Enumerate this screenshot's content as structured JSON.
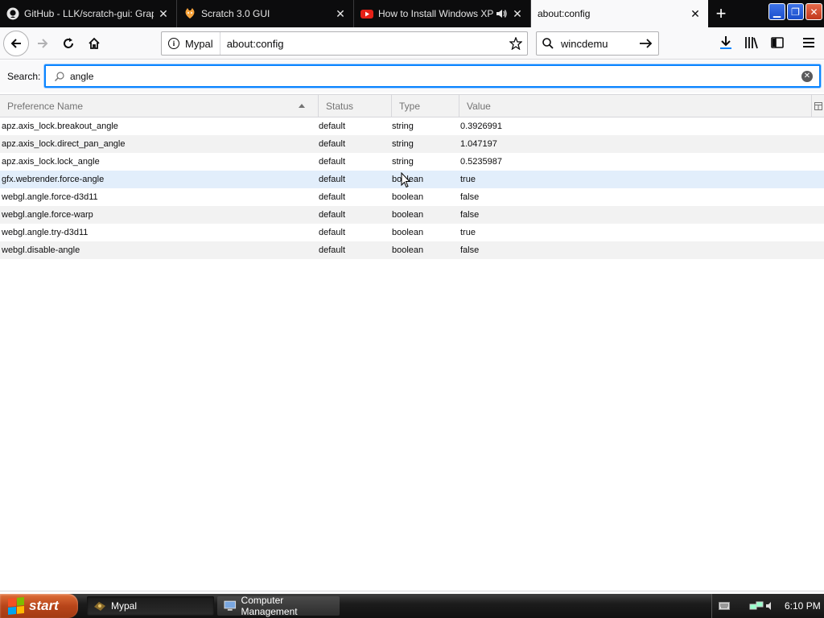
{
  "tabs": [
    {
      "title": "GitHub - LLK/scratch-gui: Graphical",
      "icon": "github-icon",
      "active": false
    },
    {
      "title": "Scratch 3.0 GUI",
      "icon": "scratch-cat-icon",
      "active": false
    },
    {
      "title": "How to Install Windows XP KVM",
      "icon": "youtube-icon",
      "active": false,
      "audio": true
    },
    {
      "title": "about:config",
      "icon": "",
      "active": true
    }
  ],
  "toolbar": {
    "identity_label": "Mypal",
    "url": "about:config",
    "search_value": "wincdemu"
  },
  "config": {
    "search_label": "Search:",
    "search_value": "angle",
    "columns": {
      "name": "Preference Name",
      "status": "Status",
      "type": "Type",
      "value": "Value"
    },
    "rows": [
      {
        "name": "apz.axis_lock.breakout_angle",
        "status": "default",
        "type": "string",
        "value": "0.3926991"
      },
      {
        "name": "apz.axis_lock.direct_pan_angle",
        "status": "default",
        "type": "string",
        "value": "1.047197"
      },
      {
        "name": "apz.axis_lock.lock_angle",
        "status": "default",
        "type": "string",
        "value": "0.5235987"
      },
      {
        "name": "gfx.webrender.force-angle",
        "status": "default",
        "type": "boolean",
        "value": "true"
      },
      {
        "name": "webgl.angle.force-d3d11",
        "status": "default",
        "type": "boolean",
        "value": "false"
      },
      {
        "name": "webgl.angle.force-warp",
        "status": "default",
        "type": "boolean",
        "value": "false"
      },
      {
        "name": "webgl.angle.try-d3d11",
        "status": "default",
        "type": "boolean",
        "value": "true"
      },
      {
        "name": "webgl.disable-angle",
        "status": "default",
        "type": "boolean",
        "value": "false"
      }
    ]
  },
  "taskbar": {
    "start_label": "start",
    "items": [
      {
        "label": "Mypal",
        "icon": "mypal-icon",
        "active": true
      },
      {
        "label": "Computer Management",
        "icon": "computer-management-icon",
        "active": false
      }
    ],
    "clock": "6:10 PM"
  },
  "colors": {
    "accent": "#0a84ff",
    "tabstrip": "#0c0c0d",
    "selected_row": "#e2eefb",
    "start_button": "#b8451a"
  }
}
